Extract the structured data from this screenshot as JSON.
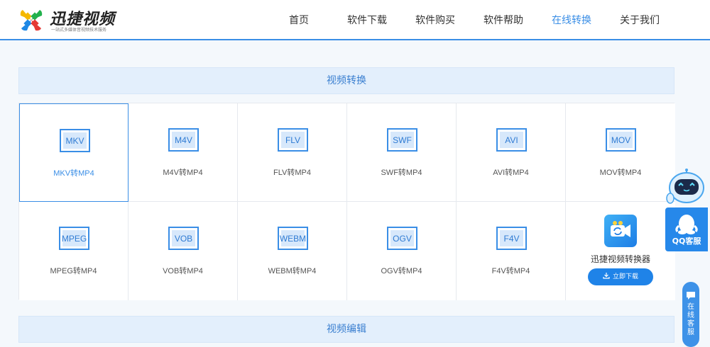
{
  "brand": {
    "name": "迅捷视频",
    "slogan": "一站式多媒体音视频技术服务"
  },
  "nav": [
    {
      "label": "首页",
      "active": false
    },
    {
      "label": "软件下载",
      "active": false
    },
    {
      "label": "软件购买",
      "active": false
    },
    {
      "label": "软件帮助",
      "active": false
    },
    {
      "label": "在线转换",
      "active": true
    },
    {
      "label": "关于我们",
      "active": false
    }
  ],
  "sections": {
    "video_convert": "视频转换",
    "video_edit": "视频编辑"
  },
  "converters": [
    {
      "format": "MKV",
      "label": "MKV转MP4",
      "selected": true
    },
    {
      "format": "M4V",
      "label": "M4V转MP4",
      "selected": false
    },
    {
      "format": "FLV",
      "label": "FLV转MP4",
      "selected": false
    },
    {
      "format": "SWF",
      "label": "SWF转MP4",
      "selected": false
    },
    {
      "format": "AVI",
      "label": "AVI转MP4",
      "selected": false
    },
    {
      "format": "MOV",
      "label": "MOV转MP4",
      "selected": false
    },
    {
      "format": "MPEG",
      "label": "MPEG转MP4",
      "selected": false
    },
    {
      "format": "VOB",
      "label": "VOB转MP4",
      "selected": false
    },
    {
      "format": "WEBM",
      "label": "WEBM转MP4",
      "selected": false
    },
    {
      "format": "OGV",
      "label": "OGV转MP4",
      "selected": false
    },
    {
      "format": "F4V",
      "label": "F4V转MP4",
      "selected": false
    }
  ],
  "promo": {
    "app_name": "迅捷视频转换器",
    "download_label": "立即下载",
    "icon": "camera-app-icon"
  },
  "widgets": {
    "qq_label": "QQ客服",
    "online_service_label": "在线客服"
  },
  "colors": {
    "accent": "#3a8ee6",
    "button": "#1f83e8",
    "section_bg": "#e3effc"
  }
}
